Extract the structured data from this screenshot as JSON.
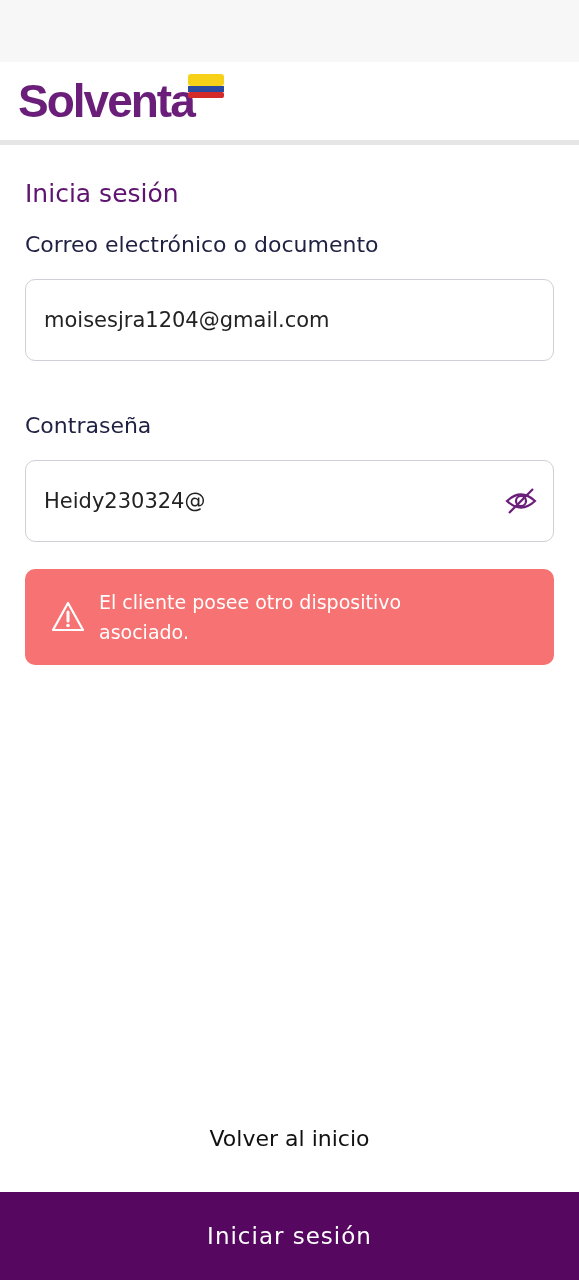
{
  "header": {
    "logo": "Solventa"
  },
  "title": "Inicia sesión",
  "fields": [
    {
      "label": "Correo electrónico o documento",
      "value": "moisesjra1204@gmail.com",
      "kind": "text"
    },
    {
      "label": "Contraseña",
      "value": "Heidy230324@",
      "kind": "password"
    }
  ],
  "alert": {
    "message": "El cliente posee otro dispositivo asociado."
  },
  "back_link": "Volver al inicio",
  "submit_button": "Iniciar sesión"
}
